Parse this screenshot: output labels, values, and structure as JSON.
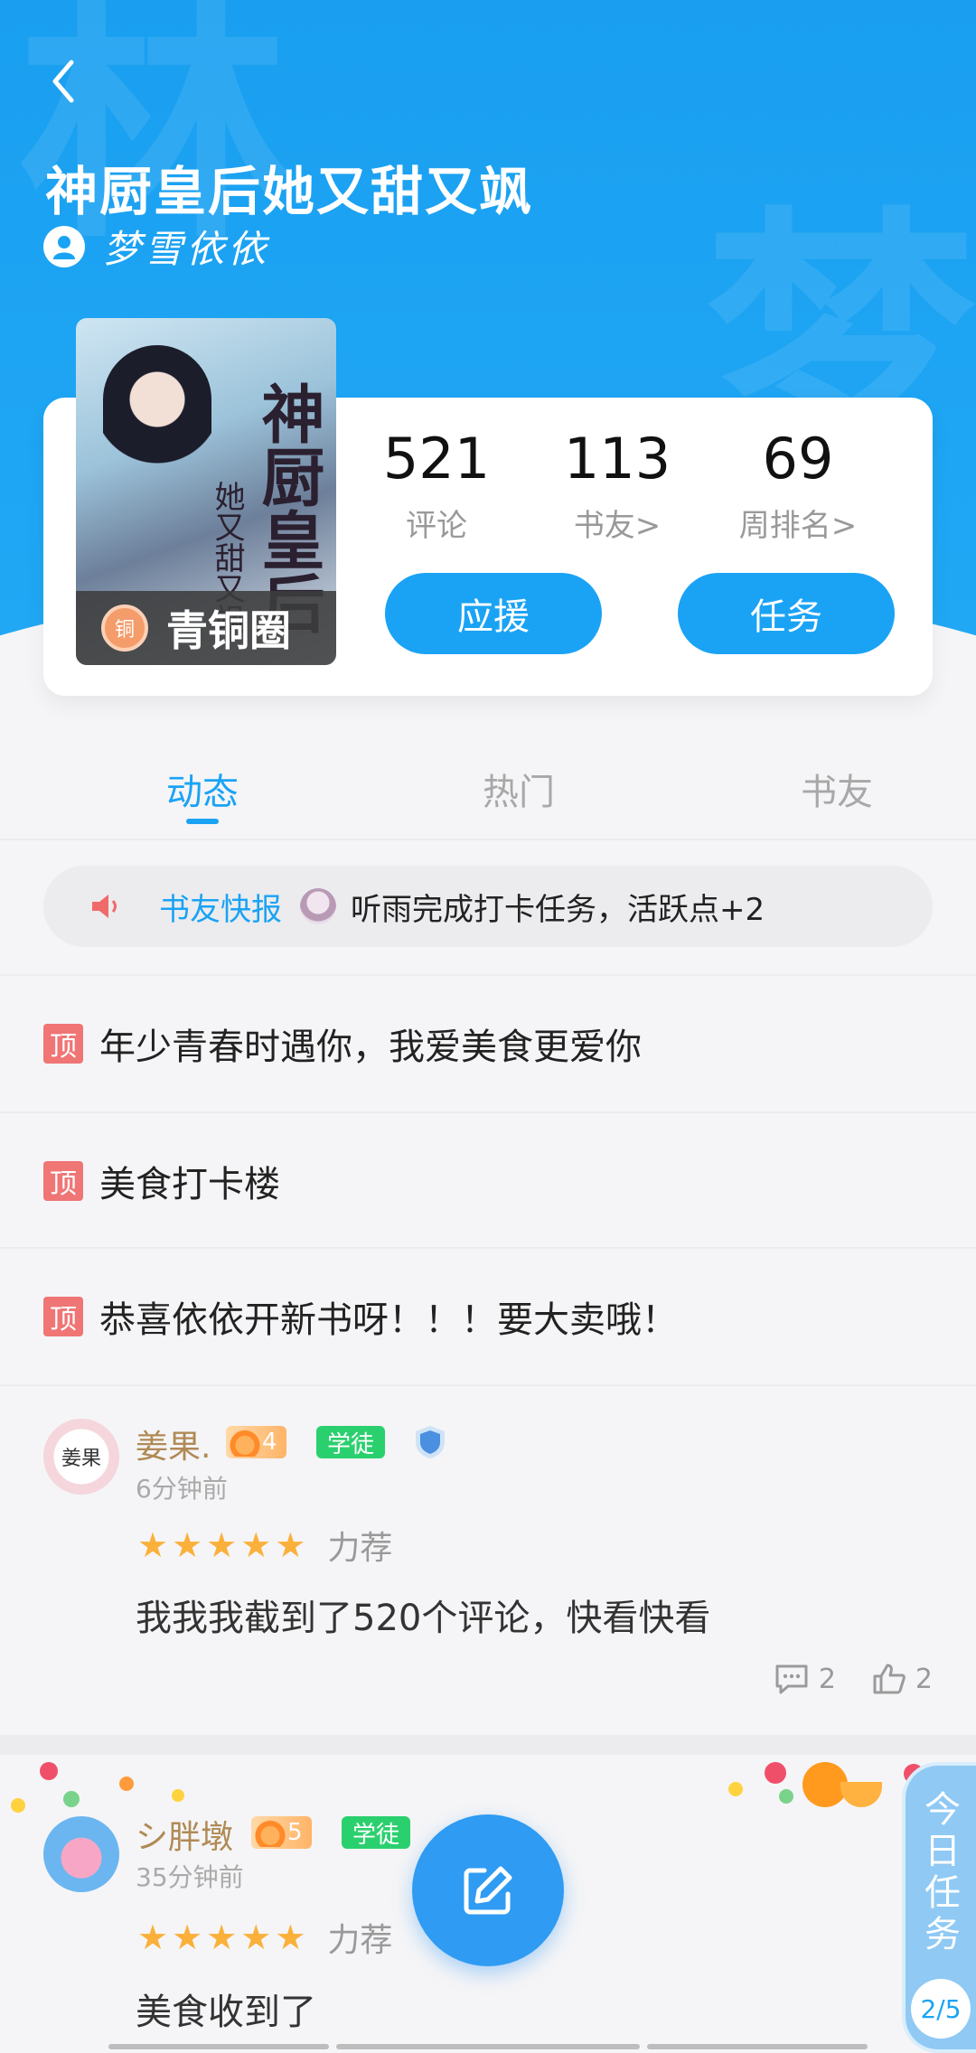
{
  "book": {
    "title": "神厨皇后她又甜又飒",
    "author": "梦雪依依",
    "cover_title": "神厨皇后",
    "cover_sub": "她又甜又飒",
    "circle_badge": "青铜圈",
    "circle_badge_icon": "铜"
  },
  "stats": [
    {
      "value": "521",
      "label": "评论"
    },
    {
      "value": "113",
      "label": "书友>"
    },
    {
      "value": "69",
      "label": "周排名>"
    }
  ],
  "actions": {
    "support": "应援",
    "tasks": "任务"
  },
  "tabs": [
    {
      "label": "动态",
      "active": true
    },
    {
      "label": "热门",
      "active": false
    },
    {
      "label": "书友",
      "active": false
    }
  ],
  "news": {
    "label": "书友快报",
    "text": "听雨完成打卡任务，活跃点+2"
  },
  "pinned": [
    {
      "tag": "顶",
      "text": "年少青春时遇你，我爱美食更爱你"
    },
    {
      "tag": "顶",
      "text": "美食打卡楼"
    },
    {
      "tag": "顶",
      "text": "恭喜依依开新书呀！！！要大卖哦！"
    }
  ],
  "posts": [
    {
      "user": "姜果.",
      "avatar_text": "姜果",
      "level": "4",
      "rank": "学徒",
      "shield_level": "4",
      "time": "6分钟前",
      "stars": 5,
      "rating_word": "力荐",
      "text": "我我我截到了520个评论，快看快看",
      "comments": "2",
      "likes": "2"
    },
    {
      "user": "シ胖墩",
      "level": "5",
      "rank": "学徒",
      "time": "35分钟前",
      "stars": 5,
      "rating_word": "力荐",
      "text": "美食收到了"
    }
  ],
  "task_panel": {
    "label": "今日任务",
    "progress": "2/5"
  },
  "colors": {
    "primary": "#1aa3f5",
    "pin": "#f07575",
    "star": "#fbb03b",
    "rank_green": "#2bd06e"
  },
  "icons": [
    "back-icon",
    "user-icon",
    "speaker-icon",
    "comment-icon",
    "like-icon",
    "edit-icon",
    "shield-icon",
    "flame-icon",
    "star-icon"
  ]
}
